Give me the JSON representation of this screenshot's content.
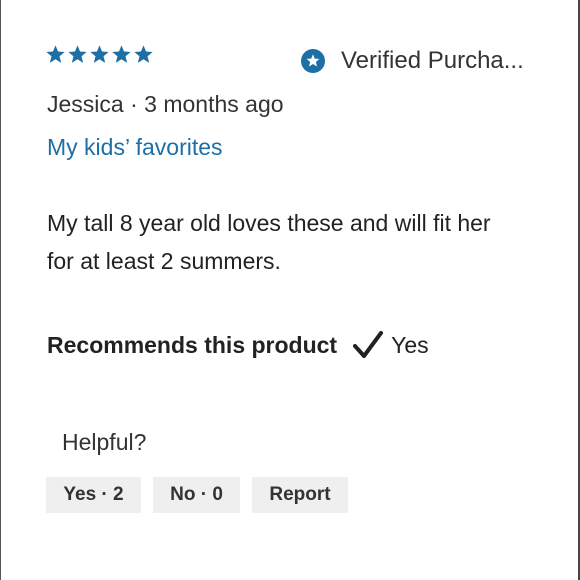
{
  "review": {
    "rating": 5,
    "max_rating": 5,
    "star_color": "#1d6fa5",
    "verified_icon": "star-badge-icon",
    "verified_label": "Verified Purcha...",
    "author": "Jessica",
    "meta_separator": "·",
    "time_ago": "3 months ago",
    "title": "My kids’ favorites",
    "title_color": "#1d6fa5",
    "body": "My tall 8 year old loves these and will fit her for at least 2 summers."
  },
  "recommendation": {
    "label": "Recommends this product",
    "icon": "checkmark-icon",
    "value": "Yes"
  },
  "helpful": {
    "prompt": "Helpful?",
    "yes_label": "Yes · 2",
    "no_label": "No · 0",
    "report_label": "Report"
  }
}
